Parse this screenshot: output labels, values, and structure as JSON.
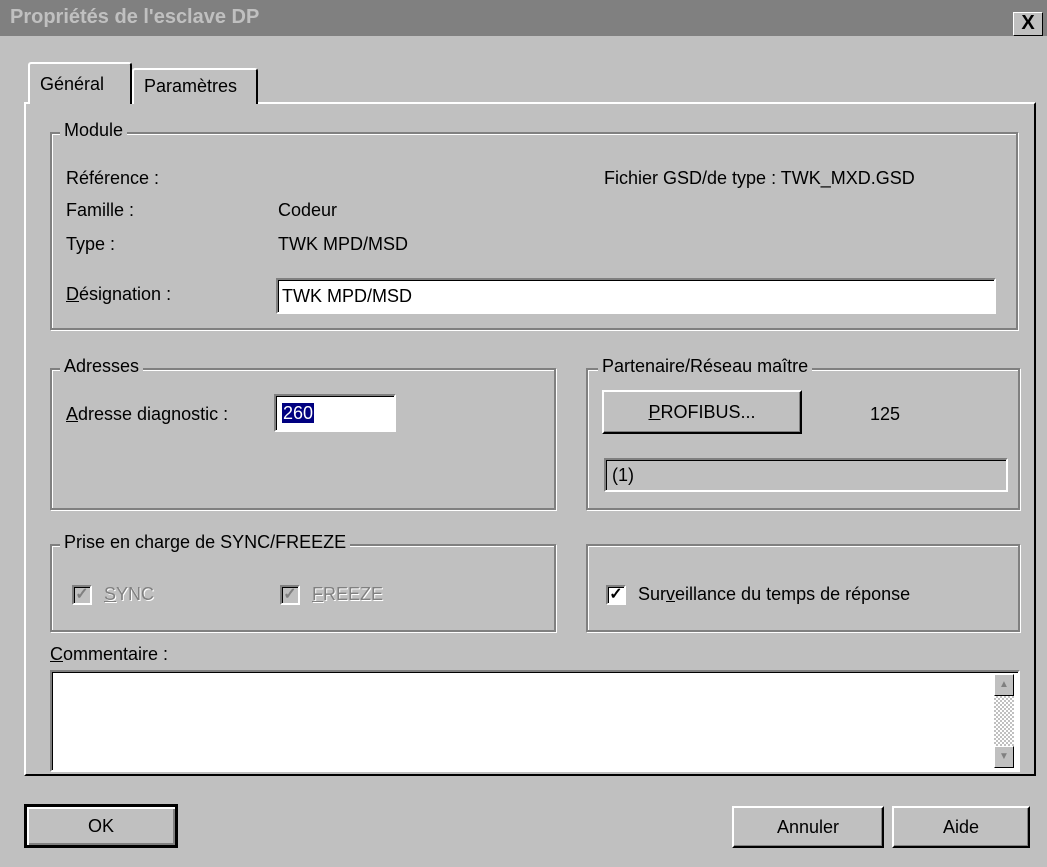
{
  "window": {
    "title": "Propriétés de l'esclave DP",
    "close_label": "X"
  },
  "tabs": [
    {
      "label": "Général",
      "selected": true
    },
    {
      "label": "Paramètres",
      "selected": false
    }
  ],
  "module": {
    "legend": "Module",
    "reference_label": "Référence :",
    "reference_value": "",
    "gsd_label": "Fichier GSD/de type : TWK_MXD.GSD",
    "famille_label": "Famille :",
    "famille_value": "Codeur",
    "type_label": "Type :",
    "type_value": "TWK MPD/MSD",
    "designation_label_mnemonic": "D",
    "designation_label_rest": "ésignation :",
    "designation_value": "TWK MPD/MSD"
  },
  "adresses": {
    "legend": "Adresses",
    "diag_label_mnemonic": "A",
    "diag_label_rest": "dresse diagnostic :",
    "diag_value": "260"
  },
  "partenaire": {
    "legend": "Partenaire/Réseau maître",
    "profibus_mnemonic": "P",
    "profibus_rest": "ROFIBUS...",
    "address": "125",
    "network_value": "(1)"
  },
  "sync_freeze": {
    "legend": "Prise en charge de SYNC/FREEZE",
    "sync_mnemonic": "S",
    "sync_rest": "YNC",
    "sync_checked": true,
    "freeze_mnemonic": "F",
    "freeze_rest": "REEZE",
    "freeze_checked": true
  },
  "surveillance": {
    "label_pre": "Sur",
    "label_mnemonic": "v",
    "label_post": "eillance du temps de réponse",
    "checked": true
  },
  "commentaire": {
    "label_mnemonic": "C",
    "label_rest": "ommentaire :",
    "value": ""
  },
  "buttons": {
    "ok": "OK",
    "annuler": "Annuler",
    "aide": "Aide"
  },
  "icons": {
    "close": "close-icon",
    "check": "checkmark-icon",
    "scroll_up": "arrow-up-icon",
    "scroll_down": "arrow-down-icon"
  }
}
